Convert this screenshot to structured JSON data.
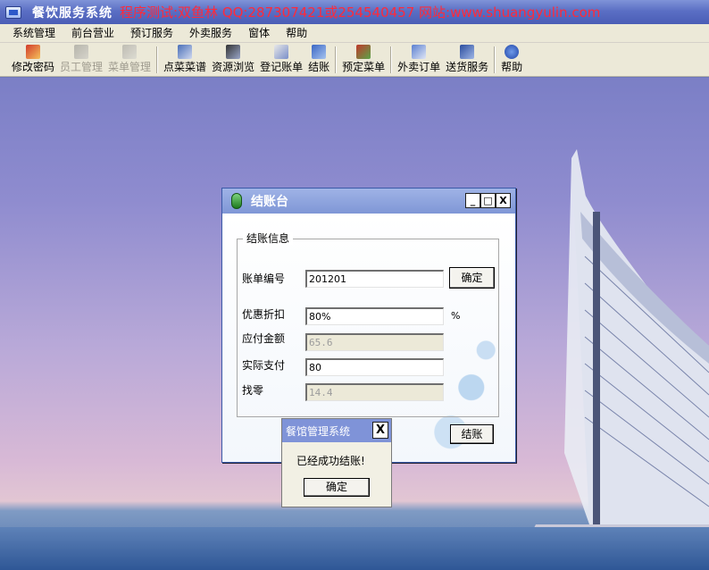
{
  "window": {
    "title": "餐饮服务系统",
    "promo": "程序测试:双鱼林 QQ:287307421或254540457 网站:www.shuangyulin.com"
  },
  "menu": [
    "系统管理",
    "前台营业",
    "预订服务",
    "外卖服务",
    "窗体",
    "帮助"
  ],
  "toolbar": {
    "change_password": "修改密码",
    "staff_manage": "员工管理",
    "menu_manage": "菜单管理",
    "order_dishes": "点菜菜谱",
    "resource_browse": "资源浏览",
    "register_bill": "登记账单",
    "checkout": "结账",
    "reserve_menu": "预定菜单",
    "takeout_order": "外卖订单",
    "delivery_service": "送货服务",
    "help": "帮助"
  },
  "checkout_dialog": {
    "title": "结账台",
    "minimize": "_",
    "maximize": "□",
    "close": "X",
    "group_title": "结账信息",
    "bill_no_label": "账单编号",
    "bill_no_value": "201201",
    "confirm_label": "确定",
    "discount_label": "优惠折扣",
    "discount_value": "80%",
    "percent_sign": "%",
    "payable_label": "应付金额",
    "payable_value": "65.6",
    "paid_label": "实际支付",
    "paid_value": "80",
    "change_label": "找零",
    "change_value": "14.4",
    "checkout_button": "结账"
  },
  "message_box": {
    "title": "餐馆管理系统",
    "close": "X",
    "message": "已经成功结账!",
    "ok_label": "确定"
  },
  "colors": {
    "title_promo": "#ff2a3a",
    "titlebar": "#5b6fc4",
    "chrome": "#ece9d8"
  }
}
